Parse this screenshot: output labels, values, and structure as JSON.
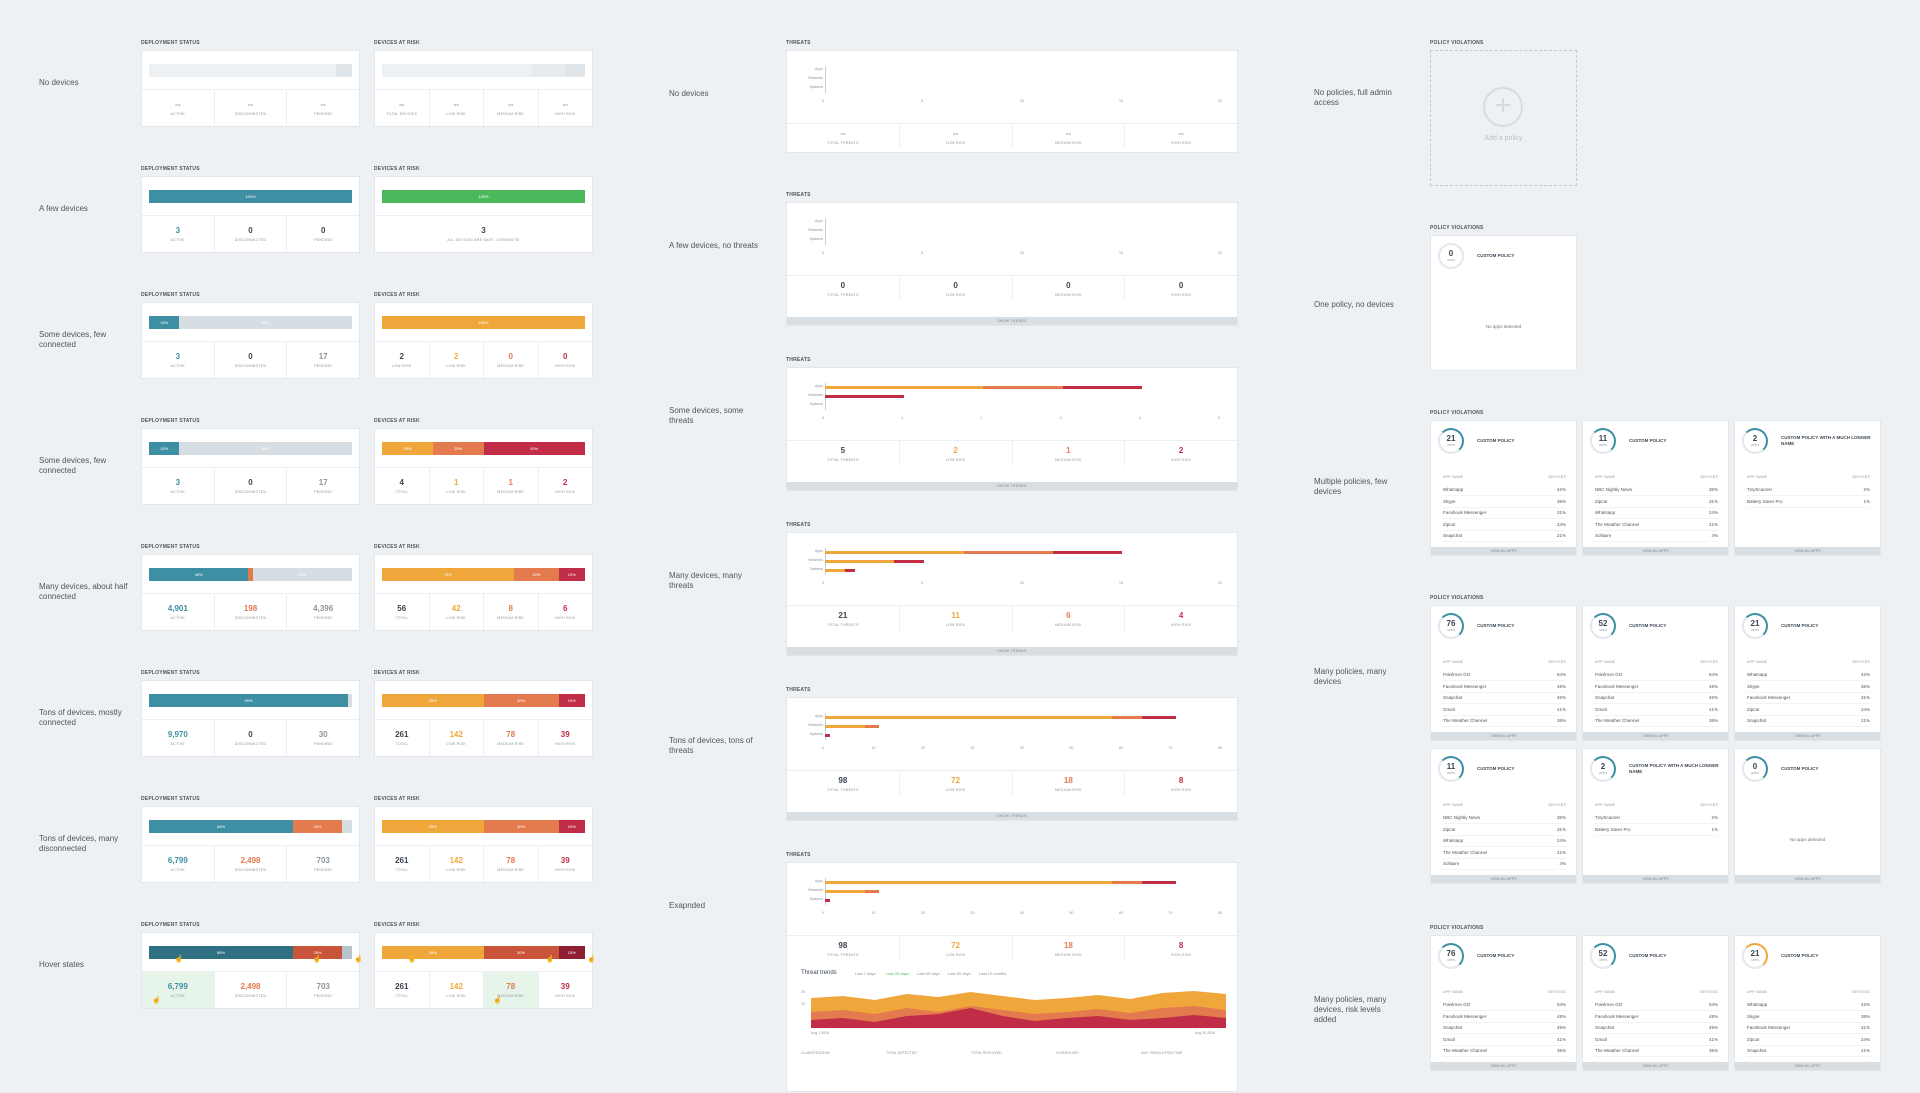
{
  "colors": {
    "teal": "#3e8fa3",
    "green": "#4cb85c",
    "orange": "#efa73c",
    "orange2": "#e37b4f",
    "red": "#c12d46",
    "gray": "#d6dde3"
  },
  "headers": {
    "deployment": "DEPLOYMENT STATUS",
    "risk": "DEVICES AT RISK",
    "threats": "THREATS",
    "policy": "POLICY VIOLATIONS"
  },
  "left_rows": [
    {
      "label": "No devices"
    },
    {
      "label": "A few devices"
    },
    {
      "label": "Some devices, few connected"
    },
    {
      "label": "Some devices, few connected"
    },
    {
      "label": "Many devices, about half connected"
    },
    {
      "label": "Tons of devices, mostly connected"
    },
    {
      "label": "Tons of devices, many disconnected"
    },
    {
      "label": "Hover states"
    }
  ],
  "deploy": [
    {
      "bar": [
        [
          "",
          "#eef1f3",
          92
        ],
        [
          "",
          "#e0e5e9",
          8
        ]
      ],
      "stats": [
        [
          "--",
          "ACTIVE",
          "gray"
        ],
        [
          "--",
          "DISCONNECTED",
          "gray"
        ],
        [
          "--",
          "PENDING",
          "gray"
        ]
      ]
    },
    {
      "bar": [
        [
          "100%",
          "#3e8fa3",
          100
        ]
      ],
      "stats": [
        [
          "3",
          "ACTIVE",
          "teal"
        ],
        [
          "0",
          "DISCONNECTED",
          "dark"
        ],
        [
          "0",
          "PENDING",
          "dark"
        ]
      ]
    },
    {
      "bar": [
        [
          "15%",
          "#3e8fa3",
          15
        ],
        [
          "85%",
          "#d6dde3",
          85
        ]
      ],
      "stats": [
        [
          "3",
          "ACTIVE",
          "teal"
        ],
        [
          "0",
          "DISCONNECTED",
          "dark"
        ],
        [
          "17",
          "PENDING",
          "gray"
        ]
      ]
    },
    {
      "bar": [
        [
          "15%",
          "#3e8fa3",
          15
        ],
        [
          "85%",
          "#d6dde3",
          85
        ]
      ],
      "stats": [
        [
          "3",
          "ACTIVE",
          "teal"
        ],
        [
          "0",
          "DISCONNECTED",
          "dark"
        ],
        [
          "17",
          "PENDING",
          "gray"
        ]
      ]
    },
    {
      "bar": [
        [
          "48%",
          "#3e8fa3",
          49
        ],
        [
          "",
          "#e37b4f",
          2
        ],
        [
          "49%",
          "#d6dde3",
          49
        ]
      ],
      "stats": [
        [
          "4,901",
          "ACTIVE",
          "teal"
        ],
        [
          "198",
          "DISCONNECTED",
          "orange2"
        ],
        [
          "4,396",
          "PENDING",
          "gray"
        ]
      ]
    },
    {
      "bar": [
        [
          "99%",
          "#3e8fa3",
          98
        ],
        [
          "",
          "#d6dde3",
          2
        ]
      ],
      "stats": [
        [
          "9,970",
          "ACTIVE",
          "teal"
        ],
        [
          "0",
          "DISCONNECTED",
          "dark"
        ],
        [
          "30",
          "PENDING",
          "gray"
        ]
      ]
    },
    {
      "bar": [
        [
          "68%",
          "#3e8fa3",
          71
        ],
        [
          "25%",
          "#e37b4f",
          24
        ],
        [
          "",
          "#d6dde3",
          5
        ]
      ],
      "stats": [
        [
          "6,799",
          "ACTIVE",
          "teal"
        ],
        [
          "2,498",
          "DISCONNECTED",
          "orange2"
        ],
        [
          "703",
          "PENDING",
          "gray"
        ]
      ]
    },
    {
      "bar": [
        [
          "68%",
          "#2f7183",
          71
        ],
        [
          "25%",
          "#c9543a",
          24
        ],
        [
          "",
          "#b9c3cb",
          5
        ]
      ],
      "stats": [
        [
          "6,799",
          "ACTIVE",
          "teal"
        ],
        [
          "2,498",
          "DISCONNECTED",
          "orange2"
        ],
        [
          "703",
          "PENDING",
          "gray"
        ]
      ],
      "hover": true
    }
  ],
  "risk": [
    {
      "bar": [
        [
          "",
          "#eef1f3",
          74
        ],
        [
          "",
          "#e7ebee",
          16
        ],
        [
          "",
          "#dfe4e8",
          10
        ]
      ],
      "stats": [
        [
          "--",
          "TOTAL DEVICES",
          "gray"
        ],
        [
          "--",
          "LOW RISK",
          "gray"
        ],
        [
          "--",
          "MEDIUM RISK",
          "gray"
        ],
        [
          "--",
          "HIGH RISK",
          "gray"
        ]
      ]
    },
    {
      "bar": [
        [
          "100%",
          "#4cb85c",
          100
        ]
      ],
      "stats": [
        [
          "3",
          "ALL DEVICES ARE SAFE. CONGRATS!",
          "dark"
        ]
      ]
    },
    {
      "bar": [
        [
          "100%",
          "#efa73c",
          100
        ]
      ],
      "stats": [
        [
          "2",
          "LOW RISK",
          "dark"
        ],
        [
          "2",
          "LOW RISK",
          "orange"
        ],
        [
          "0",
          "MEDIUM RISK",
          "orange2"
        ],
        [
          "0",
          "HIGH RISK",
          "red"
        ]
      ]
    },
    {
      "bar": [
        [
          "25%",
          "#efa73c",
          25
        ],
        [
          "25%",
          "#e37b4f",
          25
        ],
        [
          "50%",
          "#c12d46",
          50
        ]
      ],
      "stats": [
        [
          "4",
          "TOTAL",
          "dark"
        ],
        [
          "1",
          "LOW RISK",
          "orange"
        ],
        [
          "1",
          "MEDIUM RISK",
          "orange2"
        ],
        [
          "2",
          "HIGH RISK",
          "red"
        ]
      ]
    },
    {
      "bar": [
        [
          "75%",
          "#efa73c",
          65
        ],
        [
          "15%",
          "#e37b4f",
          22
        ],
        [
          "10%",
          "#c12d46",
          13
        ]
      ],
      "stats": [
        [
          "56",
          "TOTAL",
          "dark"
        ],
        [
          "42",
          "LOW RISK",
          "orange"
        ],
        [
          "8",
          "MEDIUM RISK",
          "orange2"
        ],
        [
          "6",
          "HIGH RISK",
          "red"
        ]
      ]
    },
    {
      "bar": [
        [
          "55%",
          "#efa73c",
          50
        ],
        [
          "30%",
          "#e37b4f",
          37
        ],
        [
          "15%",
          "#c12d46",
          13
        ]
      ],
      "stats": [
        [
          "261",
          "TOTAL",
          "dark"
        ],
        [
          "142",
          "LOW RISK",
          "orange"
        ],
        [
          "78",
          "MEDIUM RISK",
          "orange2"
        ],
        [
          "39",
          "HIGH RISK",
          "red"
        ]
      ]
    },
    {
      "bar": [
        [
          "55%",
          "#efa73c",
          50
        ],
        [
          "30%",
          "#e37b4f",
          37
        ],
        [
          "15%",
          "#c12d46",
          13
        ]
      ],
      "stats": [
        [
          "261",
          "TOTAL",
          "dark"
        ],
        [
          "142",
          "LOW RISK",
          "orange"
        ],
        [
          "78",
          "MEDIUM RISK",
          "orange2"
        ],
        [
          "39",
          "HIGH RISK",
          "red"
        ]
      ]
    },
    {
      "bar": [
        [
          "55%",
          "#efa73c",
          50
        ],
        [
          "30%",
          "#c9543a",
          37
        ],
        [
          "15%",
          "#8e1f33",
          13
        ]
      ],
      "stats": [
        [
          "261",
          "TOTAL",
          "dark"
        ],
        [
          "142",
          "LOW RISK",
          "orange"
        ],
        [
          "78",
          "MEDIUM RISK",
          "orange2"
        ],
        [
          "39",
          "HIGH RISK",
          "red"
        ]
      ],
      "hover": true
    }
  ],
  "mid_rows": [
    {
      "label": "No devices"
    },
    {
      "label": "A few devices, no threats"
    },
    {
      "label": "Some devices, some threats"
    },
    {
      "label": "Many devices, many threats"
    },
    {
      "label": "Tons of devices, tons of threats"
    },
    {
      "label": "Exapnded"
    }
  ],
  "threats": [
    {
      "ticks": [
        "0",
        "5",
        "10",
        "15",
        "20"
      ],
      "rows": [
        [
          0,
          0,
          0
        ],
        [
          0,
          0,
          0
        ],
        [
          0,
          0,
          0
        ]
      ],
      "max": 20,
      "stats": [
        [
          "--",
          "TOTAL THREATS",
          "gray"
        ],
        [
          "--",
          "LOW RISK",
          "gray"
        ],
        [
          "--",
          "MEDIUM RISK",
          "gray"
        ],
        [
          "--",
          "HIGH RISK",
          "gray"
        ]
      ],
      "show": false
    },
    {
      "ticks": [
        "0",
        "5",
        "10",
        "15",
        "20"
      ],
      "rows": [
        [
          0,
          0,
          0
        ],
        [
          0,
          0,
          0
        ],
        [
          0,
          0,
          0
        ]
      ],
      "max": 20,
      "stats": [
        [
          "0",
          "TOTAL THREATS",
          "dark"
        ],
        [
          "0",
          "LOW RISK",
          "dark"
        ],
        [
          "0",
          "MEDIUM RISK",
          "dark"
        ],
        [
          "0",
          "HIGH RISK",
          "dark"
        ]
      ],
      "show": true
    },
    {
      "ticks": [
        "0",
        "1",
        "2",
        "3",
        "4",
        "5"
      ],
      "rows": [
        [
          2,
          1,
          1
        ],
        [
          0,
          0,
          1
        ],
        [
          0,
          0,
          0
        ]
      ],
      "max": 5,
      "stats": [
        [
          "5",
          "TOTAL THREATS",
          "dark"
        ],
        [
          "2",
          "LOW RISK",
          "orange"
        ],
        [
          "1",
          "MEDIUM RISK",
          "orange2"
        ],
        [
          "2",
          "HIGH RISK",
          "red"
        ]
      ],
      "show": true
    },
    {
      "ticks": [
        "0",
        "5",
        "10",
        "15",
        "20"
      ],
      "rows": [
        [
          7,
          4.5,
          3.5
        ],
        [
          3.5,
          0,
          1.5
        ],
        [
          1,
          0,
          0.5
        ]
      ],
      "max": 20,
      "stats": [
        [
          "21",
          "TOTAL THREATS",
          "dark"
        ],
        [
          "11",
          "LOW RISK",
          "orange"
        ],
        [
          "6",
          "MEDIUM RISK",
          "orange2"
        ],
        [
          "4",
          "HIGH RISK",
          "red"
        ]
      ],
      "show": true
    },
    {
      "ticks": [
        "0",
        "10",
        "20",
        "30",
        "40",
        "50",
        "60",
        "70",
        "80"
      ],
      "rows": [
        [
          58,
          6,
          7
        ],
        [
          8,
          3,
          0
        ],
        [
          0,
          0,
          1
        ]
      ],
      "max": 80,
      "stats": [
        [
          "98",
          "TOTAL THREATS",
          "dark"
        ],
        [
          "72",
          "LOW RISK",
          "orange"
        ],
        [
          "18",
          "MEDIUM RISK",
          "orange2"
        ],
        [
          "8",
          "HIGH RISK",
          "red"
        ]
      ],
      "show": true
    },
    {
      "ticks": [
        "0",
        "10",
        "20",
        "30",
        "40",
        "50",
        "60",
        "70",
        "80"
      ],
      "rows": [
        [
          58,
          6,
          7
        ],
        [
          8,
          3,
          0
        ],
        [
          0,
          0,
          1
        ]
      ],
      "max": 80,
      "stats": [
        [
          "98",
          "TOTAL THREATS",
          "dark"
        ],
        [
          "72",
          "LOW RISK",
          "orange"
        ],
        [
          "18",
          "MEDIUM RISK",
          "orange2"
        ],
        [
          "8",
          "HIGH RISK",
          "red"
        ]
      ],
      "show": false
    }
  ],
  "threat_cats": [
    "Apps",
    "Networks",
    "Systems"
  ],
  "show_trends": "SHOW TRENDS",
  "trends": {
    "title": "Threat trends",
    "ranges": [
      "Last 7 days",
      "Last 30 days",
      "Last 60 days",
      "Last 90 days",
      "Last 12 months"
    ],
    "active": 1,
    "y": [
      "20",
      "10"
    ],
    "start": "Aug 1 2016",
    "end": "Aug 30 2016",
    "cols": [
      "CLASSIFICATION",
      "TOTAL DETECTED",
      "TOTAL RESOLVED",
      "% RESOLVED",
      "AVG. RESOLUTION TIME"
    ]
  },
  "right_rows": [
    {
      "label": "No policies, full admin access"
    },
    {
      "label": "One policy, no devices"
    },
    {
      "label": "Multiple policies, few devices"
    },
    {
      "label": "Many policies, many devices"
    },
    {
      "label": "Many policies, many devices, risk levels added"
    }
  ],
  "add_policy": "Add a policy",
  "no_apps": "No apps detected",
  "app_hdr": [
    "APP NAME",
    "DEVICES"
  ],
  "view_all": "VIEW ALL APPS",
  "apps_word": "APPS",
  "policies": {
    "one": {
      "count": "0",
      "title": "CUSTOM POLICY"
    },
    "few": [
      {
        "count": "21",
        "title": "CUSTOM POLICY",
        "rows": [
          [
            "Whatsapp",
            "42%"
          ],
          [
            "Skype",
            "36%"
          ],
          [
            "Facebook Messenger",
            "31%"
          ],
          [
            "Zipcar",
            "24%"
          ],
          [
            "Snapchat",
            "21%"
          ]
        ]
      },
      {
        "count": "11",
        "title": "CUSTOM POLICY",
        "rows": [
          [
            "NBC Nightly News",
            "36%"
          ],
          [
            "Zipcar",
            "31%"
          ],
          [
            "Whatsapp",
            "24%"
          ],
          [
            "The Weather Channel",
            "21%"
          ],
          [
            "Solitaire",
            "4%"
          ]
        ]
      },
      {
        "count": "2",
        "title": "CUSTOM POLICY WITH A MUCH LONGER NAME",
        "rows": [
          [
            "TinyScanner",
            "2%"
          ],
          [
            "Battery Saver Pro",
            "1%"
          ]
        ]
      }
    ],
    "many": [
      {
        "count": "76",
        "title": "CUSTOM POLICY",
        "rows": [
          [
            "Pokémon GO",
            "54%"
          ],
          [
            "Facebook Messenger",
            "48%"
          ],
          [
            "Snapchat",
            "45%"
          ],
          [
            "Gmail",
            "41%"
          ],
          [
            "The Weather Channel",
            "36%"
          ]
        ]
      },
      {
        "count": "52",
        "title": "CUSTOM POLICY",
        "rows": [
          [
            "Pokémon GO",
            "54%"
          ],
          [
            "Facebook Messenger",
            "48%"
          ],
          [
            "Snapchat",
            "45%"
          ],
          [
            "Gmail",
            "41%"
          ],
          [
            "The Weather Channel",
            "36%"
          ]
        ]
      },
      {
        "count": "21",
        "title": "CUSTOM POLICY",
        "rows": [
          [
            "Whatsapp",
            "42%"
          ],
          [
            "Skype",
            "36%"
          ],
          [
            "Facebook Messenger",
            "31%"
          ],
          [
            "Zipcar",
            "24%"
          ],
          [
            "Snapchat",
            "21%"
          ]
        ]
      },
      {
        "count": "11",
        "title": "CUSTOM POLICY",
        "rows": [
          [
            "NBC Nightly News",
            "36%"
          ],
          [
            "Zipcar",
            "31%"
          ],
          [
            "Whatsapp",
            "24%"
          ],
          [
            "The Weather Channel",
            "21%"
          ],
          [
            "Solitaire",
            "4%"
          ]
        ]
      },
      {
        "count": "2",
        "title": "CUSTOM POLICY WITH A MUCH LONGER NAME",
        "rows": [
          [
            "TinyScanner",
            "2%"
          ],
          [
            "Battery Saver Pro",
            "1%"
          ]
        ]
      },
      {
        "count": "0",
        "title": "CUSTOM POLICY",
        "rows": []
      }
    ],
    "risk": [
      {
        "count": "76",
        "title": "CUSTOM POLICY",
        "ring": "#3e8fa3",
        "rows": [
          [
            "Pokémon GO",
            "54%"
          ],
          [
            "Facebook Messenger",
            "48%"
          ],
          [
            "Snapchat",
            "45%"
          ],
          [
            "Gmail",
            "41%"
          ],
          [
            "The Weather Channel",
            "36%"
          ]
        ]
      },
      {
        "count": "52",
        "title": "CUSTOM POLICY",
        "ring": "#3e8fa3",
        "rows": [
          [
            "Pokémon GO",
            "54%"
          ],
          [
            "Facebook Messenger",
            "48%"
          ],
          [
            "Snapchat",
            "45%"
          ],
          [
            "Gmail",
            "41%"
          ],
          [
            "The Weather Channel",
            "36%"
          ]
        ]
      },
      {
        "count": "21",
        "title": "CUSTOM POLICY",
        "ring": "#efa73c",
        "rows": [
          [
            "Whatsapp",
            "42%"
          ],
          [
            "Skype",
            "36%"
          ],
          [
            "Facebook Messenger",
            "31%"
          ],
          [
            "Zipcar",
            "24%"
          ],
          [
            "Snapchat",
            "21%"
          ]
        ]
      }
    ]
  }
}
